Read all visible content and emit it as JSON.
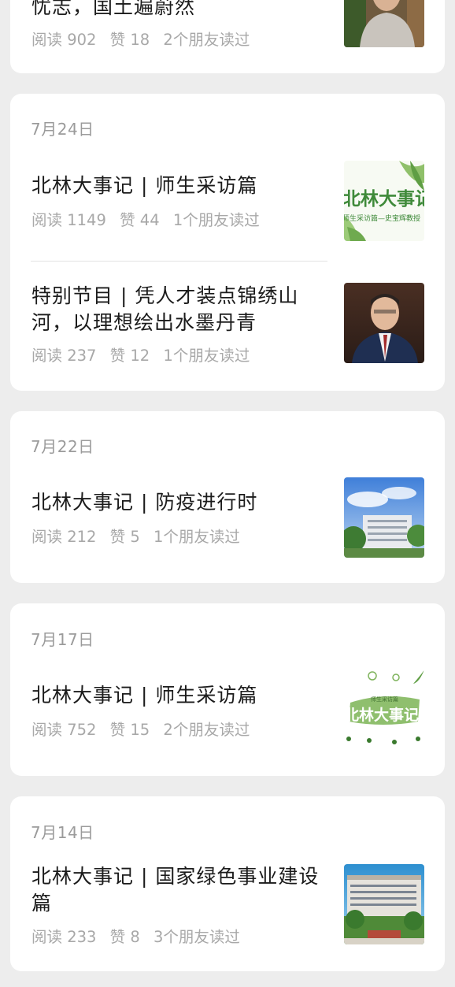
{
  "articles": [
    {
      "title": "忧志，国土遍蔚然",
      "reads_label": "阅读",
      "reads": "902",
      "likes_label": "赞",
      "likes": "18",
      "friends": "2个朋友读过",
      "thumb_icon": "person-portrait-thumbnail"
    }
  ],
  "groups": [
    {
      "date": "7月24日",
      "articles": [
        {
          "title": "北林大事记 | 师生采访篇",
          "reads_label": "阅读",
          "reads": "1149",
          "likes_label": "赞",
          "likes": "44",
          "friends": "1个朋友读过",
          "thumb_text": "北林大事记",
          "thumb_subtext": "师生采访篇—史宝辉教授"
        },
        {
          "title": "特别节目 | 凭人才装点锦绣山河，以理想绘出水墨丹青",
          "reads_label": "阅读",
          "reads": "237",
          "likes_label": "赞",
          "likes": "12",
          "friends": "1个朋友读过",
          "thumb_icon": "person-portrait-thumbnail"
        }
      ]
    },
    {
      "date": "7月22日",
      "articles": [
        {
          "title": "北林大事记 | 防疫进行时",
          "reads_label": "阅读",
          "reads": "212",
          "likes_label": "赞",
          "likes": "5",
          "friends": "1个朋友读过",
          "thumb_icon": "campus-building-thumbnail"
        }
      ]
    },
    {
      "date": "7月17日",
      "articles": [
        {
          "title": "北林大事记 | 师生采访篇",
          "reads_label": "阅读",
          "reads": "752",
          "likes_label": "赞",
          "likes": "15",
          "friends": "2个朋友读过",
          "thumb_text": "北林大事记",
          "thumb_subtext": "师生采访篇"
        }
      ]
    },
    {
      "date": "7月14日",
      "articles": [
        {
          "title": "北林大事记 | 国家绿色事业建设篇",
          "reads_label": "阅读",
          "reads": "233",
          "likes_label": "赞",
          "likes": "8",
          "friends": "3个朋友读过",
          "thumb_icon": "university-building-thumbnail"
        }
      ]
    }
  ],
  "colors": {
    "background": "#ededed",
    "card": "#ffffff",
    "title": "#1b1b1b",
    "meta": "#a8a8a8",
    "date": "#9b9b9b",
    "brand_green": "#3f8a3a"
  }
}
